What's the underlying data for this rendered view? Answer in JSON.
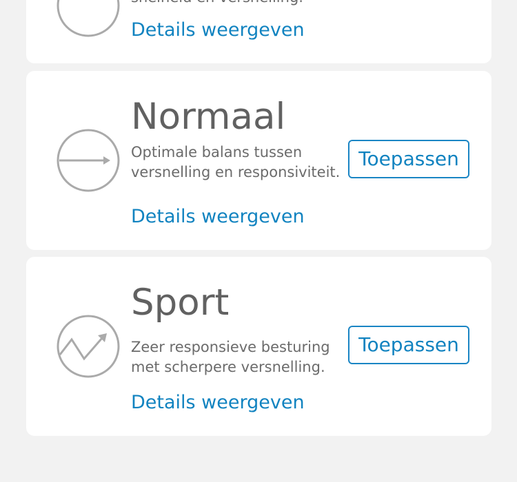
{
  "top_card": {
    "desc_partial": "snelheid en versnelling.",
    "details_label": "Details weergeven"
  },
  "modes": [
    {
      "title": "Normaal",
      "description": "Optimale balans tussen versnelling en responsiviteit.",
      "details_label": "Details weergeven",
      "apply_label": "Toepassen",
      "icon": "arrow-right-circle-icon"
    },
    {
      "title": "Sport",
      "description": "Zeer responsieve besturing met scherpere versnelling.",
      "details_label": "Details weergeven",
      "apply_label": "Toepassen",
      "icon": "zigzag-arrow-circle-icon"
    }
  ],
  "colors": {
    "accent": "#1183c0",
    "title": "#616161",
    "icon": "#aaaaaa",
    "background": "#f2f2f2",
    "card": "#ffffff"
  }
}
